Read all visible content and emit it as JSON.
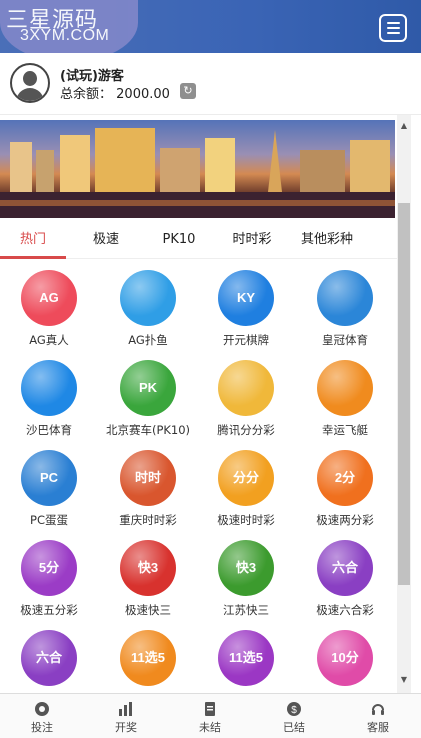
{
  "header": {
    "logo_title": "三星源码",
    "logo_sub": "3XYM.COM",
    "menu_icon": "hamburger-icon"
  },
  "user": {
    "name": "(试玩)游客",
    "balance_label": "总余额：",
    "balance_value": "2000.00",
    "refresh_icon": "refresh-icon"
  },
  "tabs": [
    {
      "label": "热门",
      "active": true
    },
    {
      "label": "极速",
      "active": false
    },
    {
      "label": "PK10",
      "active": false
    },
    {
      "label": "时时彩",
      "active": false
    },
    {
      "label": "其他彩种",
      "active": false
    }
  ],
  "games": [
    {
      "label": "AG真人",
      "icon_text": "AG",
      "color": "#ee4b5b"
    },
    {
      "label": "AG扑鱼",
      "icon_text": "",
      "color": "#2f9ee6"
    },
    {
      "label": "开元棋牌",
      "icon_text": "KY",
      "color": "#1f7fe0"
    },
    {
      "label": "皇冠体育",
      "icon_text": "",
      "color": "#2b86d8"
    },
    {
      "label": "沙巴体育",
      "icon_text": "",
      "color": "#1f88e5"
    },
    {
      "label": "北京赛车(PK10)",
      "icon_text": "PK",
      "color": "#3aa63c"
    },
    {
      "label": "腾讯分分彩",
      "icon_text": "",
      "color": "#f0b83a"
    },
    {
      "label": "幸运飞艇",
      "icon_text": "",
      "color": "#f08b1e"
    },
    {
      "label": "PC蛋蛋",
      "icon_text": "PC",
      "color": "#2a7fd3"
    },
    {
      "label": "重庆时时彩",
      "icon_text": "时时",
      "color": "#d9562e"
    },
    {
      "label": "极速时时彩",
      "icon_text": "分分",
      "color": "#f2a020"
    },
    {
      "label": "极速两分彩",
      "icon_text": "2分",
      "color": "#f0701e"
    },
    {
      "label": "极速五分彩",
      "icon_text": "5分",
      "color": "#9b3cc6"
    },
    {
      "label": "极速快三",
      "icon_text": "快3",
      "color": "#d8322e"
    },
    {
      "label": "江苏快三",
      "icon_text": "快3",
      "color": "#3c9b2e"
    },
    {
      "label": "极速六合彩",
      "icon_text": "六合",
      "color": "#8a3fc3"
    },
    {
      "label": "",
      "icon_text": "六合",
      "color": "#8a3fc3"
    },
    {
      "label": "",
      "icon_text": "11选5",
      "color": "#f08a1e"
    },
    {
      "label": "",
      "icon_text": "11选5",
      "color": "#9b37c4"
    },
    {
      "label": "",
      "icon_text": "10分",
      "color": "#e04ba8"
    }
  ],
  "footer": [
    {
      "label": "投注",
      "icon": "bet-icon"
    },
    {
      "label": "开奖",
      "icon": "chart-icon"
    },
    {
      "label": "未结",
      "icon": "document-icon"
    },
    {
      "label": "已结",
      "icon": "coin-icon"
    },
    {
      "label": "客服",
      "icon": "headset-icon"
    }
  ]
}
